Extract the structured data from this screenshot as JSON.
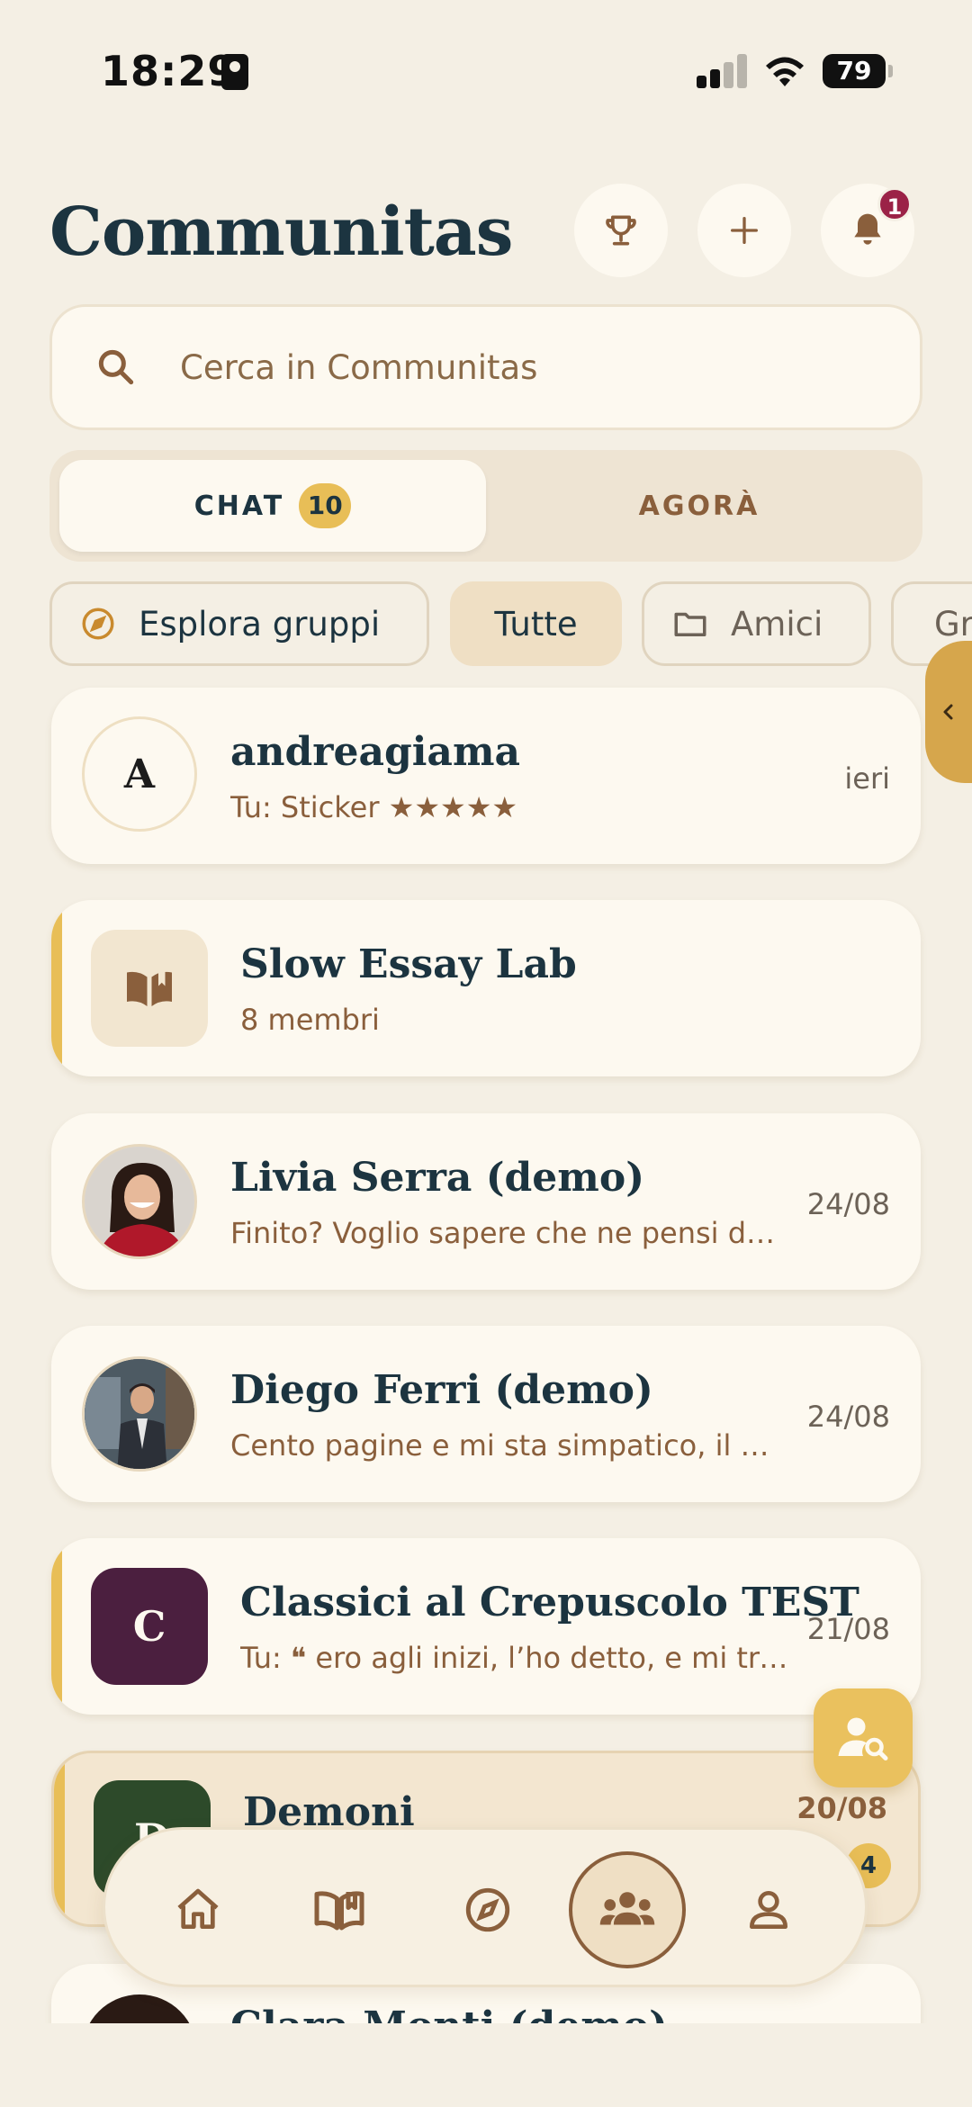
{
  "status_bar": {
    "time": "18:29",
    "battery": "79"
  },
  "header": {
    "title": "Communitas",
    "notification_count": "1"
  },
  "search": {
    "placeholder": "Cerca in Communitas"
  },
  "tabs": [
    {
      "label": "CHAT",
      "badge": "10"
    },
    {
      "label": "AGORÀ"
    }
  ],
  "chips": [
    {
      "label": "Esplora gruppi",
      "icon": "compass-icon"
    },
    {
      "label": "Tutte",
      "selected": true
    },
    {
      "label": "Amici",
      "icon": "folder-icon"
    },
    {
      "label": "Gr"
    }
  ],
  "chats": [
    {
      "name": "andreagiama",
      "avatar_letter": "A",
      "subtitle": "Tu: Sticker ★★★★★",
      "time": "ieri"
    },
    {
      "name": "Slow Essay Lab",
      "icon": "book-icon",
      "subtitle": "8 membri",
      "time": ""
    },
    {
      "name": "Livia Serra (demo)",
      "subtitle": "Finito? Voglio sapere che ne pensi del...",
      "time": "24/08"
    },
    {
      "name": "Diego Ferri (demo)",
      "subtitle": "Cento pagine e mi sta simpatico, il ch...",
      "time": "24/08"
    },
    {
      "name": "Classici al Crepuscolo TEST",
      "avatar_letter": "C",
      "subtitle": "Tu: ❝ ero agli inizi, l’ho detto, e mi trov...",
      "time": "21/08"
    },
    {
      "name": "Demoni",
      "avatar_letter": "D",
      "subtitle": "",
      "time": "20/08",
      "badge": "4"
    },
    {
      "name": "Clara Monti (demo)",
      "subtitle": "",
      "time": ""
    }
  ],
  "colors": {
    "accent": "#e8be57",
    "brown": "#8a5f3c",
    "navy": "#1c3440",
    "background": "#f4efe4"
  }
}
